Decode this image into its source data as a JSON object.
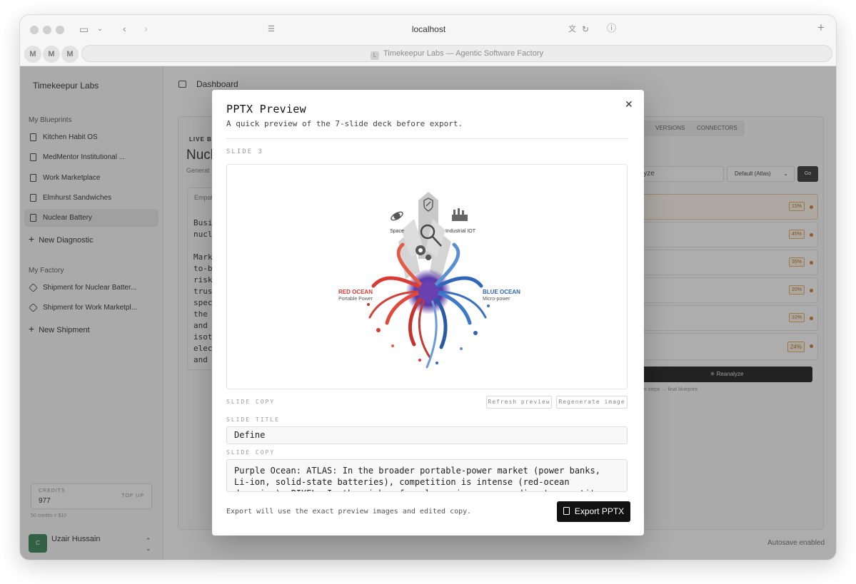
{
  "browser": {
    "url": "localhost",
    "tab_title": "Timekeepur Labs — Agentic Software Factory",
    "tab_favicon": "L",
    "pinned": [
      "M",
      "M",
      "M"
    ]
  },
  "sidebar": {
    "brand": "Timekeepur Labs",
    "blueprints_label": "My Blueprints",
    "blueprints": [
      "Kitchen Habit OS",
      "MedMentor Institutional ...",
      "Work Marketplace",
      "Elmhurst Sandwiches",
      "Nuclear Battery"
    ],
    "new_diagnostic": "New Diagnostic",
    "factory_label": "My Factory",
    "shipments": [
      "Shipment for Nuclear Batter...",
      "Shipment for Work Marketpl..."
    ],
    "new_shipment": "New Shipment",
    "credits_label": "CREDITS",
    "credits_value": "977",
    "top_up": "TOP UP",
    "rate": "50 credits = $10",
    "user_name": "Uzair Hussain",
    "avatar_text": "C"
  },
  "main": {
    "breadcrumb": "Dashboard",
    "live_tab": "LIVE BL",
    "heading_fragment": "Nucl",
    "generated_fragment": "Generat",
    "card_header": "Empat",
    "card_lines": [
      "Busin",
      "nucle",
      "",
      "Marke",
      "to-be",
      "risk p",
      "trust,",
      "speci",
      "the e",
      "and t",
      "isoto",
      "elect",
      "and r"
    ],
    "versions_tab": "VERSIONS",
    "connectors_tab": "CONNECTORS",
    "search_fragment": "lyze",
    "select_value": "Default (Atlas)",
    "go": "Go",
    "percents": [
      "15%",
      "45%",
      "35%",
      "20%",
      "10%",
      "24%"
    ],
    "reanalyze": "Reanalyze",
    "steps_note": "gn steps → final blueprint",
    "autosave": "Autosave enabled"
  },
  "modal": {
    "title": "PPTX Preview",
    "subtitle": "A quick preview of the 7-slide deck before export.",
    "slide_label": "SLIDE 3",
    "slide_image": {
      "left_title": "RED OCEAN",
      "left_sub": "Portable Power",
      "right_title": "BLUE OCEAN",
      "right_sub": "Micro-power",
      "top_left": "Space",
      "top_right": "Industrial IOT",
      "red": "#d93a34",
      "blue": "#2f66b8",
      "purple": "#6a3fb0"
    },
    "slide_copy_label": "SLIDE COPY",
    "refresh_preview": "Refresh preview",
    "regenerate_image": "Regenerate image",
    "slide_title_label": "SLIDE TITLE",
    "slide_title_value": "Define",
    "slide_copy_field_label": "SLIDE COPY",
    "slide_copy_value": "Purple Ocean: ATLAS: In the broader portable-power market (power banks, Li-ion, solid-state batteries), competition is intense (red-ocean dynamics). PIXEL: In the niche of nuclear micro-power, direct competitors are fewer, but substitutes are abundant and requ",
    "footer_note": "Export will use the exact preview images and edited copy.",
    "export_label": "Export PPTX"
  }
}
